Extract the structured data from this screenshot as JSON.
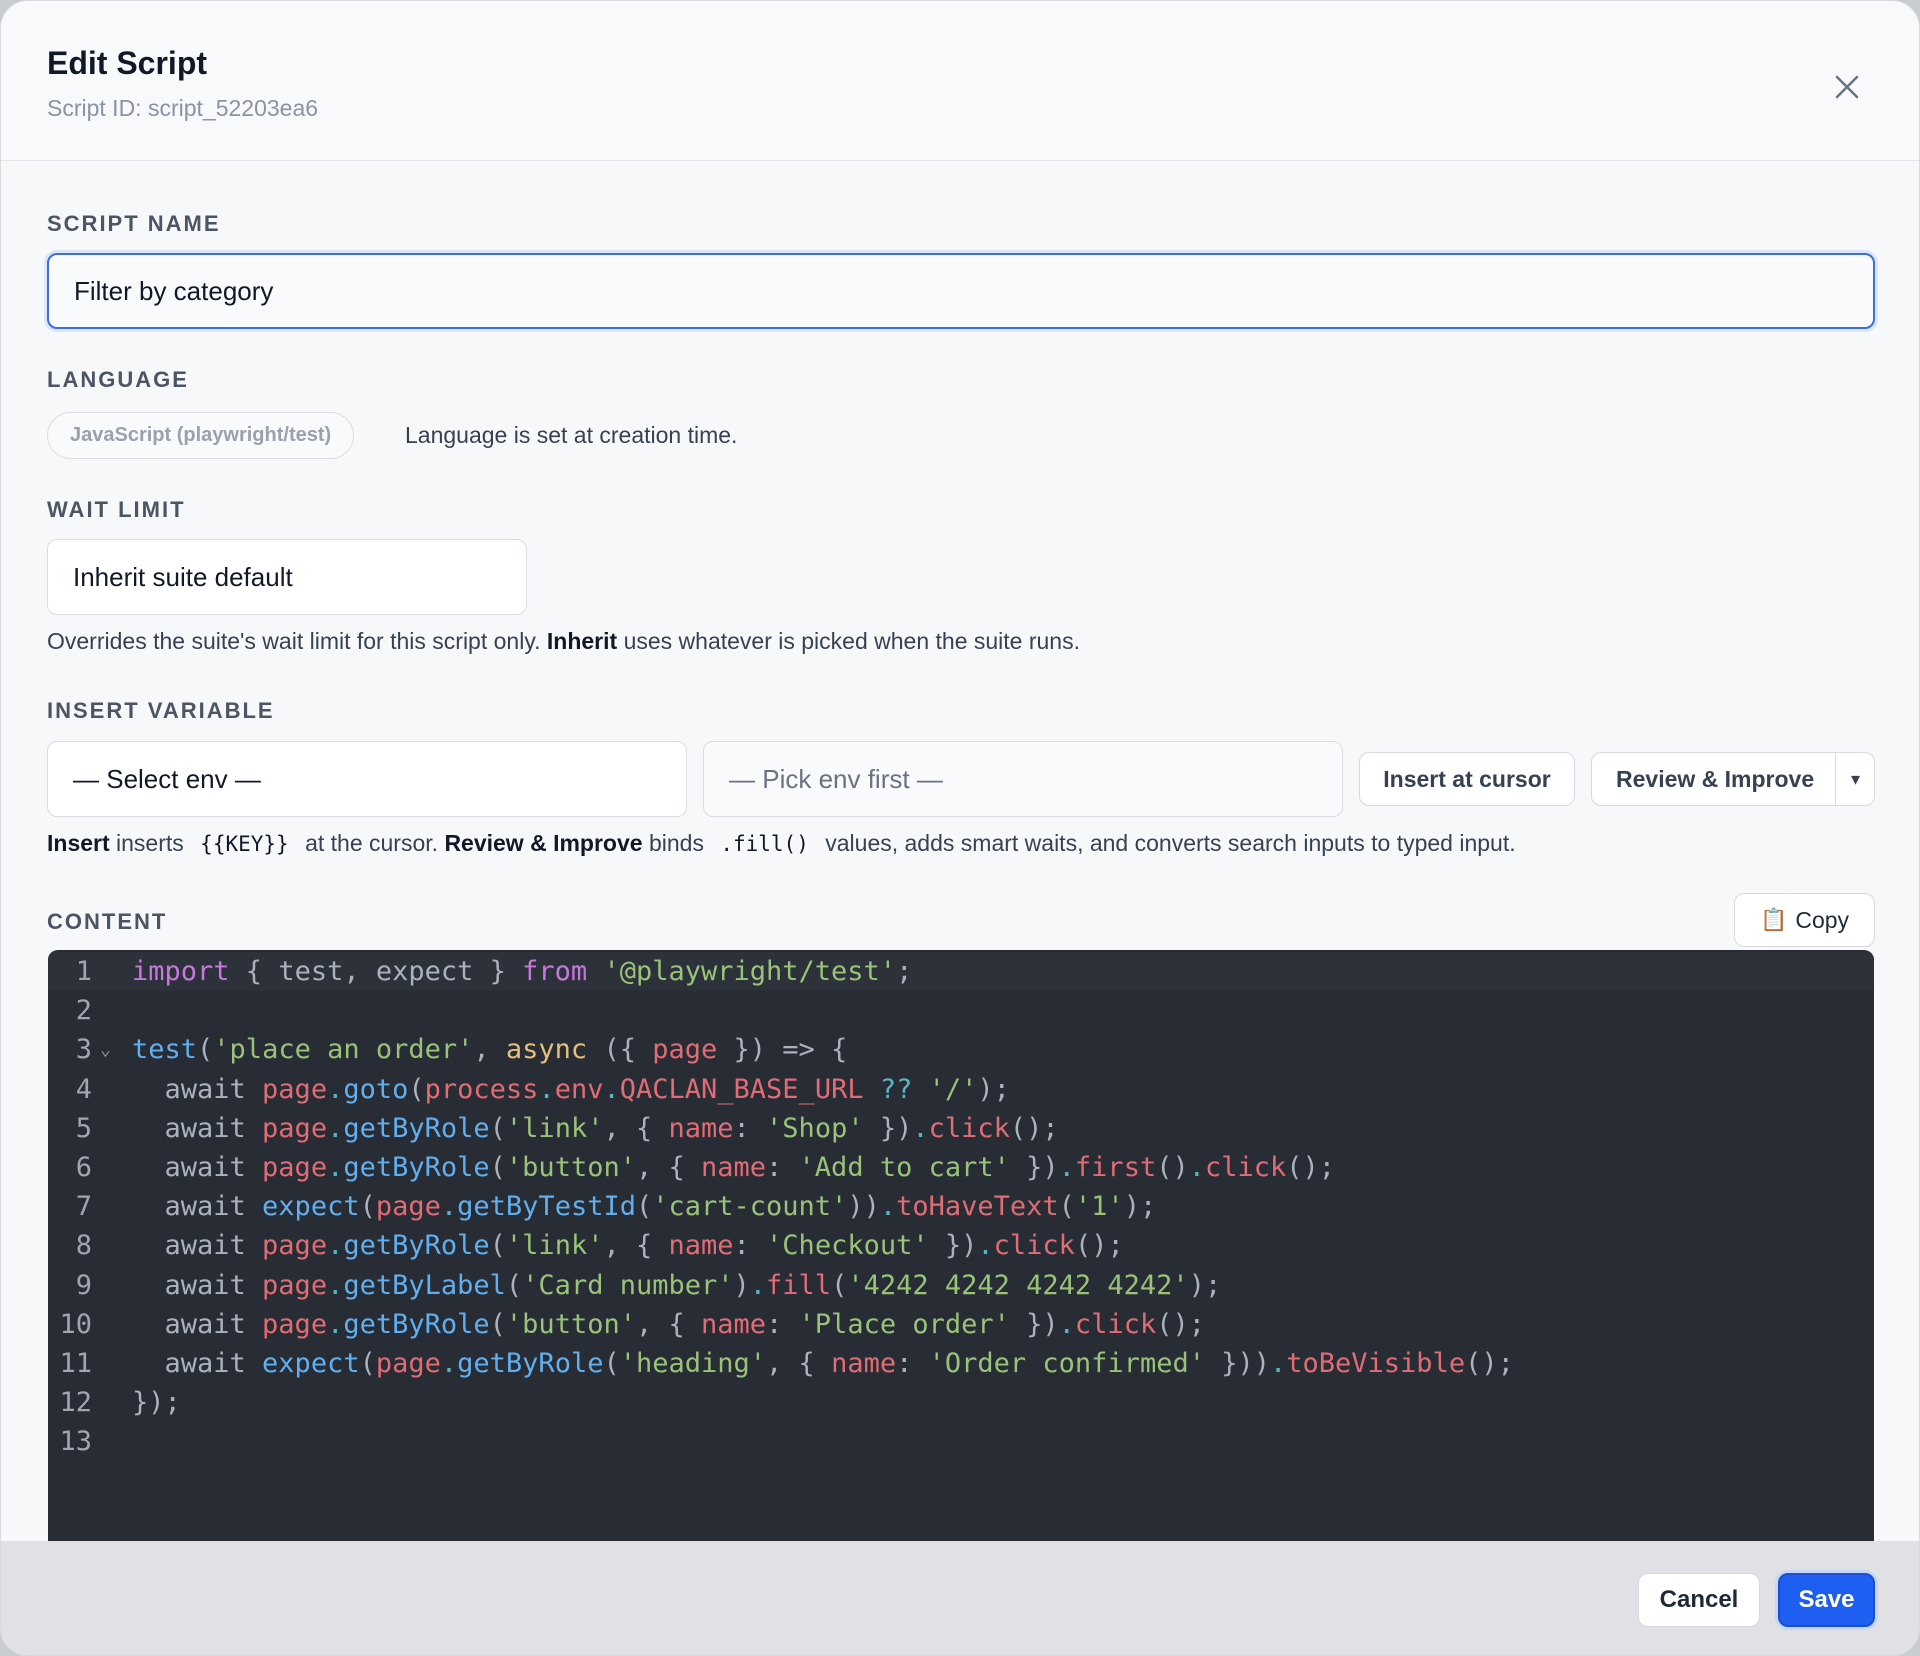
{
  "header": {
    "title": "Edit Script",
    "subtitle": "Script ID: script_52203ea6"
  },
  "script_name": {
    "label": "SCRIPT NAME",
    "value": "Filter by category"
  },
  "language": {
    "label": "LANGUAGE",
    "value": "JavaScript (playwright/test)",
    "note": "Language is set at creation time."
  },
  "wait_limit": {
    "label": "WAIT LIMIT",
    "value": "Inherit suite default",
    "help_pre": "Overrides the suite's wait limit for this script only.",
    "help_bold": "Inherit",
    "help_post": "uses whatever is picked when the suite runs."
  },
  "insert_variable": {
    "label": "INSERT VARIABLE",
    "env_select": "— Select env —",
    "key_select": "— Pick env first —",
    "insert_button": "Insert at cursor",
    "review_button": "Review & Improve",
    "dropdown_arrow": "▾",
    "help_b1": "Insert",
    "help_t1": "inserts",
    "help_c1": "{{KEY}}",
    "help_t2": "at the cursor.",
    "help_b2": "Review & Improve",
    "help_t3": "binds",
    "help_c2": ".fill()",
    "help_t4": "values, adds smart waits, and converts search inputs to typed input."
  },
  "content": {
    "label": "CONTENT",
    "copy_button": "Copy",
    "copy_icon": "📋",
    "line_numbers": [
      "1",
      "2",
      "3",
      "4",
      "5",
      "6",
      "7",
      "8",
      "9",
      "10",
      "11",
      "12",
      "13"
    ],
    "fold_marker": "⌄",
    "lines": [
      [
        [
          "kw",
          "import"
        ],
        [
          "p",
          " { test, expect } "
        ],
        [
          "kw",
          "from"
        ],
        [
          "p",
          " "
        ],
        [
          "str",
          "'@playwright/test'"
        ],
        [
          "p",
          ";"
        ]
      ],
      [],
      [
        [
          "fn",
          "test"
        ],
        [
          "p",
          "("
        ],
        [
          "str",
          "'place an order'"
        ],
        [
          "p",
          ", "
        ],
        [
          "nb",
          "async"
        ],
        [
          "p",
          " ({ "
        ],
        [
          "vr",
          "page"
        ],
        [
          "p",
          " }) => {"
        ]
      ],
      [
        [
          "p",
          "  await "
        ],
        [
          "vr",
          "page"
        ],
        [
          "op",
          "."
        ],
        [
          "fn",
          "goto"
        ],
        [
          "p",
          "("
        ],
        [
          "vr",
          "process"
        ],
        [
          "op",
          "."
        ],
        [
          "vr",
          "env"
        ],
        [
          "op",
          "."
        ],
        [
          "vr",
          "QACLAN_BASE_URL"
        ],
        [
          "p",
          " "
        ],
        [
          "op",
          "??"
        ],
        [
          "p",
          " "
        ],
        [
          "str",
          "'/'"
        ],
        [
          "p",
          ");"
        ]
      ],
      [
        [
          "p",
          "  await "
        ],
        [
          "vr",
          "page"
        ],
        [
          "op",
          "."
        ],
        [
          "fn",
          "getByRole"
        ],
        [
          "p",
          "("
        ],
        [
          "str",
          "'link'"
        ],
        [
          "p",
          ", { "
        ],
        [
          "vr",
          "name"
        ],
        [
          "p",
          ": "
        ],
        [
          "str",
          "'Shop'"
        ],
        [
          "p",
          " })"
        ],
        [
          "op",
          "."
        ],
        [
          "vr",
          "click"
        ],
        [
          "p",
          "();"
        ]
      ],
      [
        [
          "p",
          "  await "
        ],
        [
          "vr",
          "page"
        ],
        [
          "op",
          "."
        ],
        [
          "fn",
          "getByRole"
        ],
        [
          "p",
          "("
        ],
        [
          "str",
          "'button'"
        ],
        [
          "p",
          ", { "
        ],
        [
          "vr",
          "name"
        ],
        [
          "p",
          ": "
        ],
        [
          "str",
          "'Add to cart'"
        ],
        [
          "p",
          " })"
        ],
        [
          "op",
          "."
        ],
        [
          "vr",
          "first"
        ],
        [
          "p",
          "()"
        ],
        [
          "op",
          "."
        ],
        [
          "vr",
          "click"
        ],
        [
          "p",
          "();"
        ]
      ],
      [
        [
          "p",
          "  await "
        ],
        [
          "fn",
          "expect"
        ],
        [
          "p",
          "("
        ],
        [
          "vr",
          "page"
        ],
        [
          "op",
          "."
        ],
        [
          "fn",
          "getByTestId"
        ],
        [
          "p",
          "("
        ],
        [
          "str",
          "'cart-count'"
        ],
        [
          "p",
          "))"
        ],
        [
          "op",
          "."
        ],
        [
          "vr",
          "toHaveText"
        ],
        [
          "p",
          "("
        ],
        [
          "str",
          "'1'"
        ],
        [
          "p",
          ");"
        ]
      ],
      [
        [
          "p",
          "  await "
        ],
        [
          "vr",
          "page"
        ],
        [
          "op",
          "."
        ],
        [
          "fn",
          "getByRole"
        ],
        [
          "p",
          "("
        ],
        [
          "str",
          "'link'"
        ],
        [
          "p",
          ", { "
        ],
        [
          "vr",
          "name"
        ],
        [
          "p",
          ": "
        ],
        [
          "str",
          "'Checkout'"
        ],
        [
          "p",
          " })"
        ],
        [
          "op",
          "."
        ],
        [
          "vr",
          "click"
        ],
        [
          "p",
          "();"
        ]
      ],
      [
        [
          "p",
          "  await "
        ],
        [
          "vr",
          "page"
        ],
        [
          "op",
          "."
        ],
        [
          "fn",
          "getByLabel"
        ],
        [
          "p",
          "("
        ],
        [
          "str",
          "'Card number'"
        ],
        [
          "p",
          ")"
        ],
        [
          "op",
          "."
        ],
        [
          "vr",
          "fill"
        ],
        [
          "p",
          "("
        ],
        [
          "str",
          "'4242 4242 4242 4242'"
        ],
        [
          "p",
          ");"
        ]
      ],
      [
        [
          "p",
          "  await "
        ],
        [
          "vr",
          "page"
        ],
        [
          "op",
          "."
        ],
        [
          "fn",
          "getByRole"
        ],
        [
          "p",
          "("
        ],
        [
          "str",
          "'button'"
        ],
        [
          "p",
          ", { "
        ],
        [
          "vr",
          "name"
        ],
        [
          "p",
          ": "
        ],
        [
          "str",
          "'Place order'"
        ],
        [
          "p",
          " })"
        ],
        [
          "op",
          "."
        ],
        [
          "vr",
          "click"
        ],
        [
          "p",
          "();"
        ]
      ],
      [
        [
          "p",
          "  await "
        ],
        [
          "fn",
          "expect"
        ],
        [
          "p",
          "("
        ],
        [
          "vr",
          "page"
        ],
        [
          "op",
          "."
        ],
        [
          "fn",
          "getByRole"
        ],
        [
          "p",
          "("
        ],
        [
          "str",
          "'heading'"
        ],
        [
          "p",
          ", { "
        ],
        [
          "vr",
          "name"
        ],
        [
          "p",
          ": "
        ],
        [
          "str",
          "'Order confirmed'"
        ],
        [
          "p",
          " }))"
        ],
        [
          "op",
          "."
        ],
        [
          "vr",
          "toBeVisible"
        ],
        [
          "p",
          "();"
        ]
      ],
      [
        [
          "p",
          "});"
        ]
      ],
      []
    ]
  },
  "footer": {
    "cancel": "Cancel",
    "save": "Save"
  }
}
